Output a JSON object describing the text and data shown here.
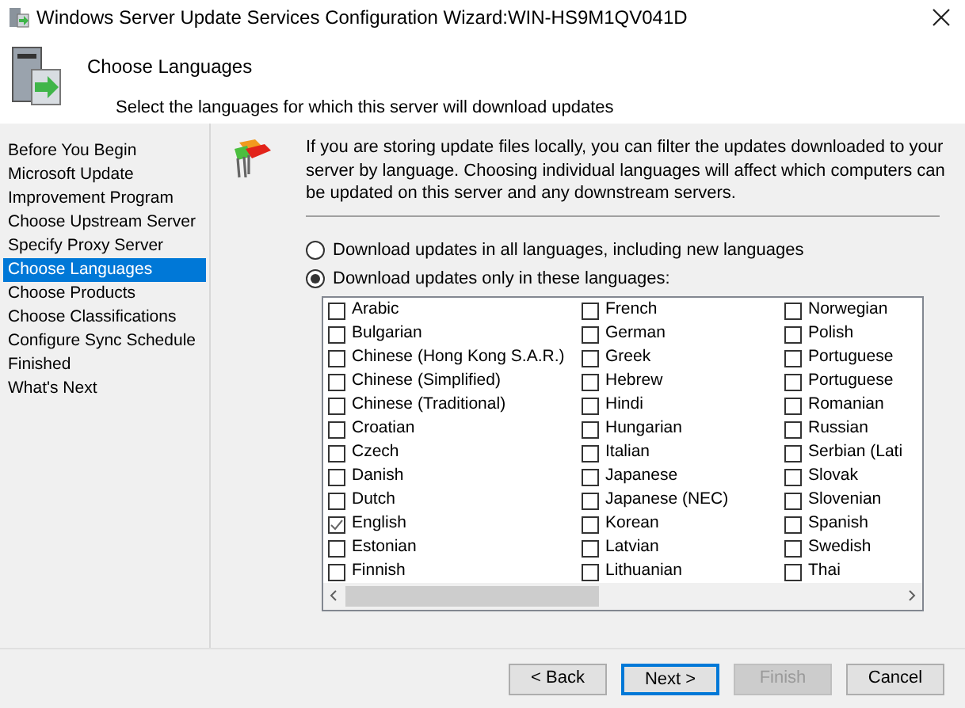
{
  "window": {
    "title": "Windows Server Update Services Configuration Wizard:WIN-HS9M1QV041D"
  },
  "header": {
    "title": "Choose Languages",
    "subtitle": "Select the languages for which this server will download updates"
  },
  "sidebar": {
    "items": [
      {
        "label": "Before You Begin",
        "selected": false
      },
      {
        "label": "Microsoft Update Improvement Program",
        "selected": false
      },
      {
        "label": "Choose Upstream Server",
        "selected": false
      },
      {
        "label": "Specify Proxy Server",
        "selected": false
      },
      {
        "label": "Choose Languages",
        "selected": true
      },
      {
        "label": "Choose Products",
        "selected": false
      },
      {
        "label": "Choose Classifications",
        "selected": false
      },
      {
        "label": "Configure Sync Schedule",
        "selected": false
      },
      {
        "label": "Finished",
        "selected": false
      },
      {
        "label": "What's Next",
        "selected": false
      }
    ]
  },
  "description": "If you are storing update files locally, you can filter the updates downloaded to your server by language. Choosing individual languages will affect which computers can be updated on this server and any downstream servers.",
  "options": [
    {
      "label": "Download updates in all languages, including new languages",
      "selected": false
    },
    {
      "label": "Download updates only in these languages:",
      "selected": true
    }
  ],
  "languages": [
    [
      {
        "label": "Arabic",
        "checked": false
      },
      {
        "label": "Bulgarian",
        "checked": false
      },
      {
        "label": "Chinese (Hong Kong S.A.R.)",
        "checked": false
      },
      {
        "label": "Chinese (Simplified)",
        "checked": false
      },
      {
        "label": "Chinese (Traditional)",
        "checked": false
      },
      {
        "label": "Croatian",
        "checked": false
      },
      {
        "label": "Czech",
        "checked": false
      },
      {
        "label": "Danish",
        "checked": false
      },
      {
        "label": "Dutch",
        "checked": false
      },
      {
        "label": "English",
        "checked": true
      },
      {
        "label": "Estonian",
        "checked": false
      },
      {
        "label": "Finnish",
        "checked": false
      }
    ],
    [
      {
        "label": "French",
        "checked": false
      },
      {
        "label": "German",
        "checked": false
      },
      {
        "label": "Greek",
        "checked": false
      },
      {
        "label": "Hebrew",
        "checked": false
      },
      {
        "label": "Hindi",
        "checked": false
      },
      {
        "label": "Hungarian",
        "checked": false
      },
      {
        "label": "Italian",
        "checked": false
      },
      {
        "label": "Japanese",
        "checked": false
      },
      {
        "label": "Japanese (NEC)",
        "checked": false
      },
      {
        "label": "Korean",
        "checked": false
      },
      {
        "label": "Latvian",
        "checked": false
      },
      {
        "label": "Lithuanian",
        "checked": false
      }
    ],
    [
      {
        "label": "Norwegian",
        "checked": false
      },
      {
        "label": "Polish",
        "checked": false
      },
      {
        "label": "Portuguese",
        "checked": false
      },
      {
        "label": "Portuguese",
        "checked": false
      },
      {
        "label": "Romanian",
        "checked": false
      },
      {
        "label": "Russian",
        "checked": false
      },
      {
        "label": "Serbian (Lati",
        "checked": false
      },
      {
        "label": "Slovak",
        "checked": false
      },
      {
        "label": "Slovenian",
        "checked": false
      },
      {
        "label": "Spanish",
        "checked": false
      },
      {
        "label": "Swedish",
        "checked": false
      },
      {
        "label": "Thai",
        "checked": false
      }
    ]
  ],
  "buttons": [
    {
      "label": "< Back",
      "disabled": false,
      "default": false
    },
    {
      "label": "Next >",
      "disabled": false,
      "default": true
    },
    {
      "label": "Finish",
      "disabled": true,
      "default": false
    },
    {
      "label": "Cancel",
      "disabled": false,
      "default": false
    }
  ]
}
